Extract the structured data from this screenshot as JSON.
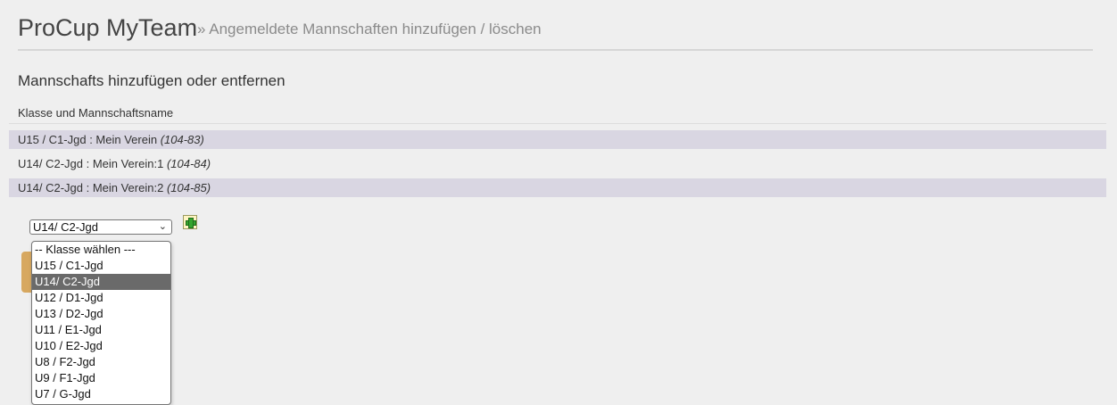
{
  "header": {
    "title": "ProCup MyTeam",
    "breadcrumb": "» Angemeldete Mannschaften hinzufügen / löschen"
  },
  "section": {
    "title": "Mannschafts hinzufügen oder entfernen",
    "column_header": "Klasse und Mannschaftsname"
  },
  "teams": [
    {
      "name": "U15 / C1-Jgd : Mein Verein",
      "code": "(104-83)"
    },
    {
      "name": "U14/ C2-Jgd : Mein Verein:1",
      "code": "(104-84)"
    },
    {
      "name": "U14/ C2-Jgd : Mein Verein:2",
      "code": "(104-85)"
    }
  ],
  "class_select": {
    "selected": "U14/ C2-Jgd",
    "options": [
      "-- Klasse wählen ---",
      "U15 / C1-Jgd",
      "U14/ C2-Jgd",
      "U12 / D1-Jgd",
      "U13 / D2-Jgd",
      "U11 / E1-Jgd",
      "U10 / E2-Jgd",
      "U8 / F2-Jgd",
      "U9 / F1-Jgd",
      "U7 / G-Jgd"
    ],
    "highlighted_index": 2
  },
  "colors": {
    "row_shade": "#d9d6e2",
    "option_highlight": "#6a6a6a",
    "add_icon_green": "#35a52e",
    "orange_button": "#d7a860"
  },
  "icons": {
    "add": "green-plus-icon",
    "chevron": "chevron-down-icon"
  }
}
